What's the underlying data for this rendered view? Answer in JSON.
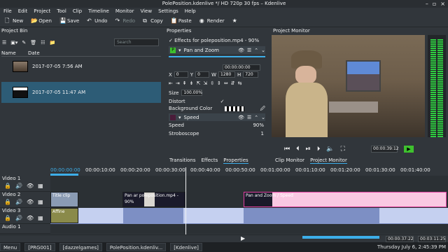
{
  "window": {
    "title": "PolePosition.kdenlive */ HD 720p 30 fps – Kdenlive"
  },
  "menu": [
    "File",
    "Edit",
    "Project",
    "Tool",
    "Clip",
    "Timeline",
    "Monitor",
    "View",
    "Settings",
    "Help"
  ],
  "toolbar": {
    "new": "New",
    "open": "Open",
    "save": "Save",
    "undo": "Undo",
    "redo": "Redo",
    "copy": "Copy",
    "paste": "Paste",
    "render": "Render"
  },
  "bin": {
    "title": "Project Bin",
    "search_placeholder": "Search",
    "col_name": "Name",
    "col_date": "Date",
    "items": [
      {
        "date": "2017-07-05 7:56 AM"
      },
      {
        "date": "2017-07-05 11:47 AM"
      }
    ]
  },
  "properties": {
    "title": "Properties",
    "effects_header": "Effects for poleposition.mp4 - 90%",
    "effect1": "Pan and Zoom",
    "timecode": "00:00:00:00",
    "x_label": "X",
    "x_value": "0",
    "y_label": "Y",
    "y_value": "0",
    "w_label": "W",
    "w_value": "1280",
    "h_label": "H",
    "h_value": "720",
    "size_label": "Size",
    "size_value": "100.00%",
    "distort_label": "Distort",
    "bgcolor_label": "Background Color",
    "effect2": "Speed",
    "speed_label": "Speed",
    "speed_value": "90%",
    "strobo_label": "Stroboscope",
    "strobo_value": "1",
    "tabs": [
      "Transitions",
      "Effects",
      "Properties"
    ]
  },
  "monitor": {
    "title": "Project Monitor",
    "timecode": "00:00:39:12",
    "tabs": [
      "Clip Monitor",
      "Project Monitor"
    ]
  },
  "timeline": {
    "ruler": [
      "00:00:00:00",
      "00:00:10:00",
      "00:00:20:00",
      "00:00:30:00",
      "00:00:40:00",
      "00:00:50:00",
      "00:01:00:00",
      "00:01:10:00",
      "00:01:20:00",
      "00:01:30:00",
      "00:01:40:00"
    ],
    "tracks": [
      "Video 1",
      "Video 2",
      "Video 3",
      "Audio 1"
    ],
    "clips": {
      "title": "Title clip",
      "pan": "Pan ar",
      "pole": "poleposition.mp4 - 90%",
      "panspeed": "Pan and Zoom / Speed",
      "affine": "Affine"
    }
  },
  "status": {
    "position": "00:00:37:22",
    "duration": "00:03:11:25"
  },
  "taskbar": {
    "menu": "Menu",
    "tasks": [
      "[PRG001]",
      "[dazzelgames]",
      "PolePosition.kdenliv...",
      "[Kdenlive]"
    ],
    "clock": "Thursday July 6, 2:45:39 PM"
  },
  "colors": {
    "accent": "#3daee9",
    "selection": "#2d5c76",
    "pink": "#f9c8e2",
    "blue": "#7d8fc4"
  }
}
